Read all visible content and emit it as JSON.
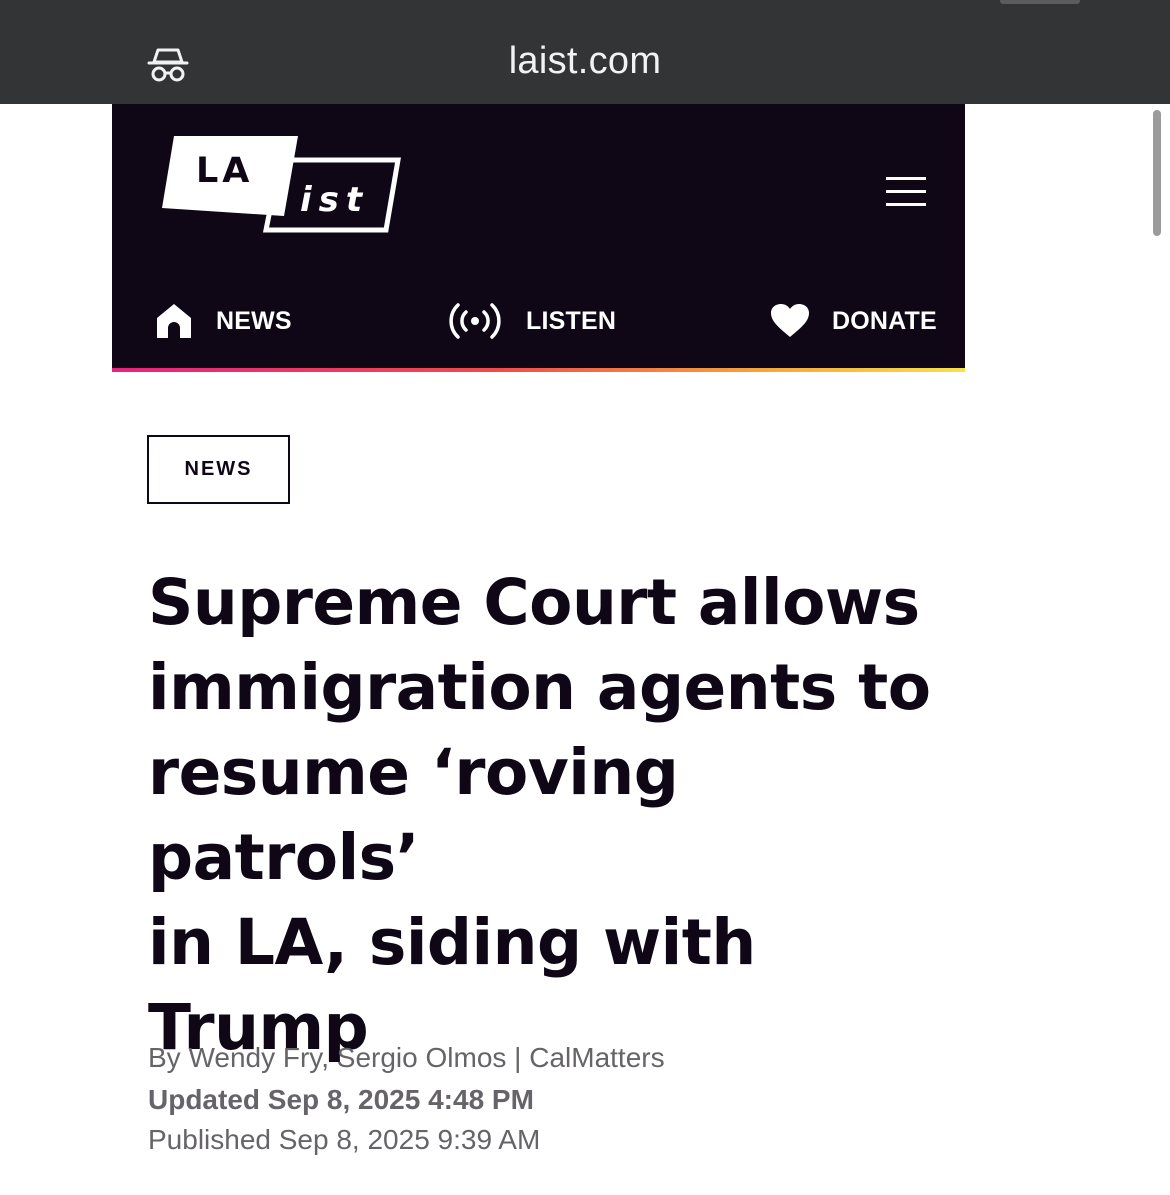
{
  "browser": {
    "url": "laist.com",
    "incognito_icon": "incognito-icon"
  },
  "site": {
    "logo": {
      "top_text": "LA",
      "bottom_text": "ist"
    },
    "menu_icon": "hamburger-menu-icon",
    "nav": [
      {
        "label": "NEWS",
        "icon": "home-icon"
      },
      {
        "label": "LISTEN",
        "icon": "broadcast-icon"
      },
      {
        "label": "DONATE",
        "icon": "heart-icon"
      }
    ],
    "colors": {
      "header_bg": "#0f0716",
      "gradient": [
        "#e6247e",
        "#ef4b4b",
        "#f6a13a",
        "#f8e14a"
      ]
    }
  },
  "article": {
    "category": "NEWS",
    "headline_lines": [
      "Supreme Court allows",
      "immigration agents to",
      "resume ‘roving patrols’",
      "in LA, siding with",
      "Trump"
    ],
    "byline": "By Wendy Fry, Sergio Olmos | CalMatters",
    "updated": "Updated Sep 8, 2025 4:48 PM",
    "published": "Published Sep 8, 2025 9:39 AM"
  }
}
